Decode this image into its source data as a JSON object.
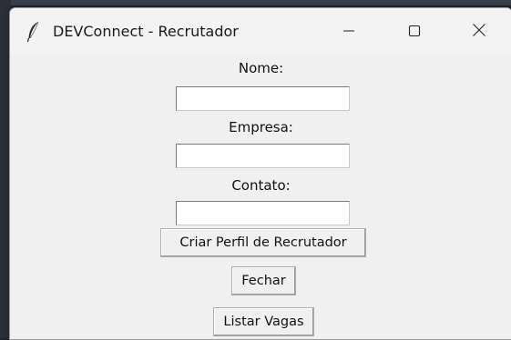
{
  "window": {
    "title": "DEVConnect - Recrutador",
    "controls": {
      "minimize_icon": "minimize-icon",
      "maximize_icon": "maximize-icon",
      "close_icon": "close-icon"
    },
    "app_icon": "feather-icon"
  },
  "form": {
    "nome": {
      "label": "Nome:",
      "value": ""
    },
    "empresa": {
      "label": "Empresa:",
      "value": ""
    },
    "contato": {
      "label": "Contato:",
      "value": ""
    }
  },
  "buttons": {
    "criar_perfil": "Criar Perfil de Recrutador",
    "fechar": "Fechar",
    "listar_vagas": "Listar Vagas"
  },
  "colors": {
    "window_bg": "#f0f0f0",
    "button_bg": "#f0f0f0",
    "entry_bg": "#ffffff"
  }
}
